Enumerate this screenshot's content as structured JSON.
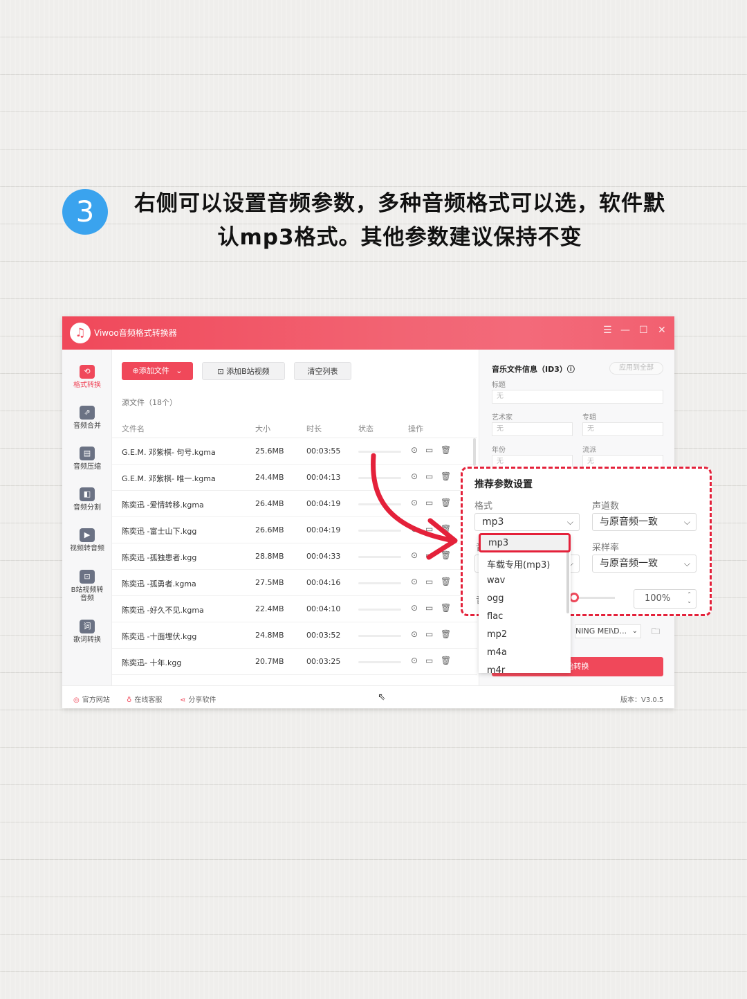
{
  "heading": {
    "step": "3",
    "line1": "右侧可以设置音频参数，多种音频格式可以选，软件默",
    "line2": "认mp3格式。其他参数建议保持不变"
  },
  "app": {
    "title": "Viwoo音频格式转换器",
    "window_controls": [
      "☰",
      "—",
      "☐",
      "✕"
    ],
    "accent": "#f0485a"
  },
  "sidebar": {
    "items": [
      {
        "label": "格式转换",
        "icon": "convert-icon",
        "glyph": "⟲"
      },
      {
        "label": "音频合并",
        "icon": "merge-icon",
        "glyph": "⇗"
      },
      {
        "label": "音频压缩",
        "icon": "compress-icon",
        "glyph": "▤"
      },
      {
        "label": "音频分割",
        "icon": "split-icon",
        "glyph": "◧"
      },
      {
        "label": "视频转音频",
        "icon": "video-icon",
        "glyph": "▶"
      },
      {
        "label": "B站视频转",
        "label2": "音频",
        "icon": "bilibili-icon",
        "glyph": "⊡"
      },
      {
        "label": "歌词转换",
        "icon": "lyrics-icon",
        "glyph": "词"
      }
    ]
  },
  "toolbar": {
    "add_file": "⊕添加文件",
    "add_bilibili": "添加B站视频",
    "clear_list": "清空列表"
  },
  "source_label": "源文件（18个）",
  "table": {
    "headers": [
      "文件名",
      "大小",
      "时长",
      "状态",
      "操作"
    ],
    "rows": [
      {
        "name": "G.E.M. 邓紫棋- 句号.kgma",
        "size": "25.6MB",
        "duration": "00:03:55"
      },
      {
        "name": "G.E.M. 邓紫棋- 唯一.kgma",
        "size": "24.4MB",
        "duration": "00:04:13"
      },
      {
        "name": "陈奕迅 -爱情转移.kgma",
        "size": "26.4MB",
        "duration": "00:04:19"
      },
      {
        "name": "陈奕迅 -富士山下.kgg",
        "size": "26.6MB",
        "duration": "00:04:19"
      },
      {
        "name": "陈奕迅 -孤独患者.kgg",
        "size": "28.8MB",
        "duration": "00:04:33"
      },
      {
        "name": "陈奕迅 -孤勇者.kgma",
        "size": "27.5MB",
        "duration": "00:04:16"
      },
      {
        "name": "陈奕迅 -好久不见.kgma",
        "size": "22.4MB",
        "duration": "00:04:10"
      },
      {
        "name": "陈奕迅 -十面埋伏.kgg",
        "size": "24.8MB",
        "duration": "00:03:52"
      },
      {
        "name": "陈奕迅- 十年.kgg",
        "size": "20.7MB",
        "duration": "00:03:25"
      }
    ]
  },
  "right_panel": {
    "title": "音乐文件信息（ID3）ⓘ",
    "apply_all": "应用到全部",
    "fields": {
      "title_label": "标题",
      "title_value": "无",
      "artist_label": "艺术家",
      "artist_value": "无",
      "album_label": "专辑",
      "album_value": "无",
      "year_label": "年份",
      "year_value": "无",
      "genre_label": "流派",
      "genre_value": "无"
    },
    "output_folder": "NING MEI\\D...",
    "start_button": "始转换"
  },
  "settings": {
    "title": "推荐参数设置",
    "format_label": "格式",
    "format_value": "mp3",
    "channels_label": "声道数",
    "channels_value": "与原音频一致",
    "sample_label": "采样率",
    "sample_value": "与原音频一致",
    "volume_percent": "100%",
    "hidden_label_1": "音",
    "hidden_label_2": "音"
  },
  "dropdown": {
    "selected": "mp3",
    "options": [
      "车载专用(mp3)",
      "wav",
      "ogg",
      "flac",
      "mp2",
      "m4a",
      "m4r"
    ]
  },
  "footer": {
    "official_site": "官方网站",
    "online_service": "在线客服",
    "share": "分享软件",
    "version": "版本：V3.0.5"
  }
}
